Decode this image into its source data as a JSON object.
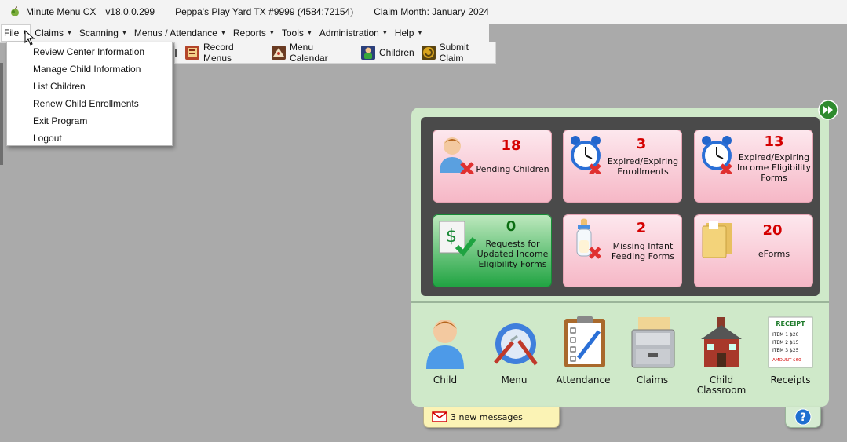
{
  "titlebar": {
    "app_name": "Minute Menu CX",
    "version": "v18.0.0.299",
    "center": "Peppa's Play Yard TX #9999 (4584:72154)",
    "claim_month": "Claim Month: January 2024"
  },
  "menubar": {
    "items": [
      "File",
      "Claims",
      "Scanning",
      "Menus / Attendance",
      "Reports",
      "Tools",
      "Administration",
      "Help"
    ]
  },
  "file_menu": {
    "items": [
      "Review Center Information",
      "Manage Child Information",
      "List Children",
      "Renew Child Enrollments",
      "Exit Program",
      "Logout"
    ]
  },
  "toolbar": {
    "buttons": [
      {
        "label": "Record Menus",
        "icon": "record-menus-icon"
      },
      {
        "label": "Menu Calendar",
        "icon": "menu-calendar-icon"
      },
      {
        "label": "Children",
        "icon": "children-icon"
      },
      {
        "label": "Submit Claim",
        "icon": "submit-claim-icon"
      }
    ]
  },
  "alerts": [
    {
      "count": "18",
      "label": "Pending Children",
      "icon": "pending-child-icon"
    },
    {
      "count": "3",
      "label": "Expired/Expiring Enrollments",
      "icon": "alarm-clock-icon"
    },
    {
      "count": "13",
      "label": "Expired/Expiring Income Eligibility Forms",
      "icon": "alarm-clock-icon"
    },
    {
      "count": "0",
      "label": "Requests for Updated Income Eligibility Forms",
      "icon": "dollar-document-check-icon"
    },
    {
      "count": "2",
      "label": "Missing Infant Feeding Forms",
      "icon": "baby-bottle-icon"
    },
    {
      "count": "20",
      "label": "eForms",
      "icon": "folder-icon"
    }
  ],
  "nav": [
    {
      "label": "Child",
      "icon": "child-icon"
    },
    {
      "label": "Menu",
      "icon": "plate-fork-knife-icon"
    },
    {
      "label": "Attendance",
      "icon": "clipboard-checklist-icon"
    },
    {
      "label": "Claims",
      "icon": "file-cabinet-icon"
    },
    {
      "label": "Child Classroom",
      "icon": "schoolhouse-icon"
    },
    {
      "label": "Receipts",
      "icon": "receipt-icon"
    }
  ],
  "receipt_icon_text": {
    "title": "RECEIPT",
    "lines": [
      "ITEM 1  $20",
      "ITEM 2  $15",
      "ITEM 3  $25"
    ],
    "total": "AMOUNT  $60"
  },
  "messages": {
    "text": "3 new messages"
  },
  "colors": {
    "dashboard_bg": "#cfe9c9",
    "alert_panel_bg": "#4a4a4a",
    "alert_card_pink": "#f6b7c6",
    "alert_card_green": "#1fa341",
    "alert_count_red": "#d40000",
    "alert_count_green": "#0b6d12",
    "messages_bg": "#fbf3b5"
  }
}
